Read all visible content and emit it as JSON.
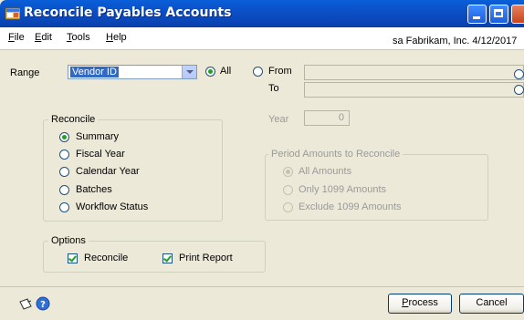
{
  "window": {
    "title": "Reconcile Payables Accounts",
    "icon": "app-window-icon"
  },
  "menubar": {
    "items": [
      {
        "label": "File",
        "accel": "F",
        "rest": "ile"
      },
      {
        "label": "Edit",
        "accel": "E",
        "rest": "dit"
      },
      {
        "label": "Tools",
        "accel": "T",
        "rest": "ools"
      },
      {
        "label": "Help",
        "accel": "H",
        "rest": "elp"
      }
    ],
    "company_info": "sa  Fabrikam, Inc.  4/12/2017"
  },
  "range": {
    "label": "Range",
    "selected": "Vendor ID",
    "all_label": "All",
    "from_label": "From",
    "to_label": "To",
    "mode": "All"
  },
  "year": {
    "label": "Year",
    "value": "0"
  },
  "reconcile": {
    "title": "Reconcile",
    "options": [
      "Summary",
      "Fiscal Year",
      "Calendar Year",
      "Batches",
      "Workflow Status"
    ],
    "selected": "Summary"
  },
  "period_amounts": {
    "title": "Period Amounts to Reconcile",
    "options": [
      "All Amounts",
      "Only 1099 Amounts",
      "Exclude 1099 Amounts"
    ],
    "selected": "All Amounts",
    "enabled": false
  },
  "options": {
    "title": "Options",
    "reconcile_label": "Reconcile",
    "reconcile_checked": true,
    "print_report_label": "Print Report",
    "print_report_checked": true
  },
  "buttons": {
    "process": {
      "accel": "P",
      "rest": "rocess"
    },
    "cancel": "Cancel"
  },
  "status_icons": [
    "note-icon",
    "help-icon"
  ],
  "colors": {
    "titlebar": "#0a52d0",
    "face": "#ece9d8",
    "selection": "#316ac5",
    "radio_dot": "#21a121"
  }
}
